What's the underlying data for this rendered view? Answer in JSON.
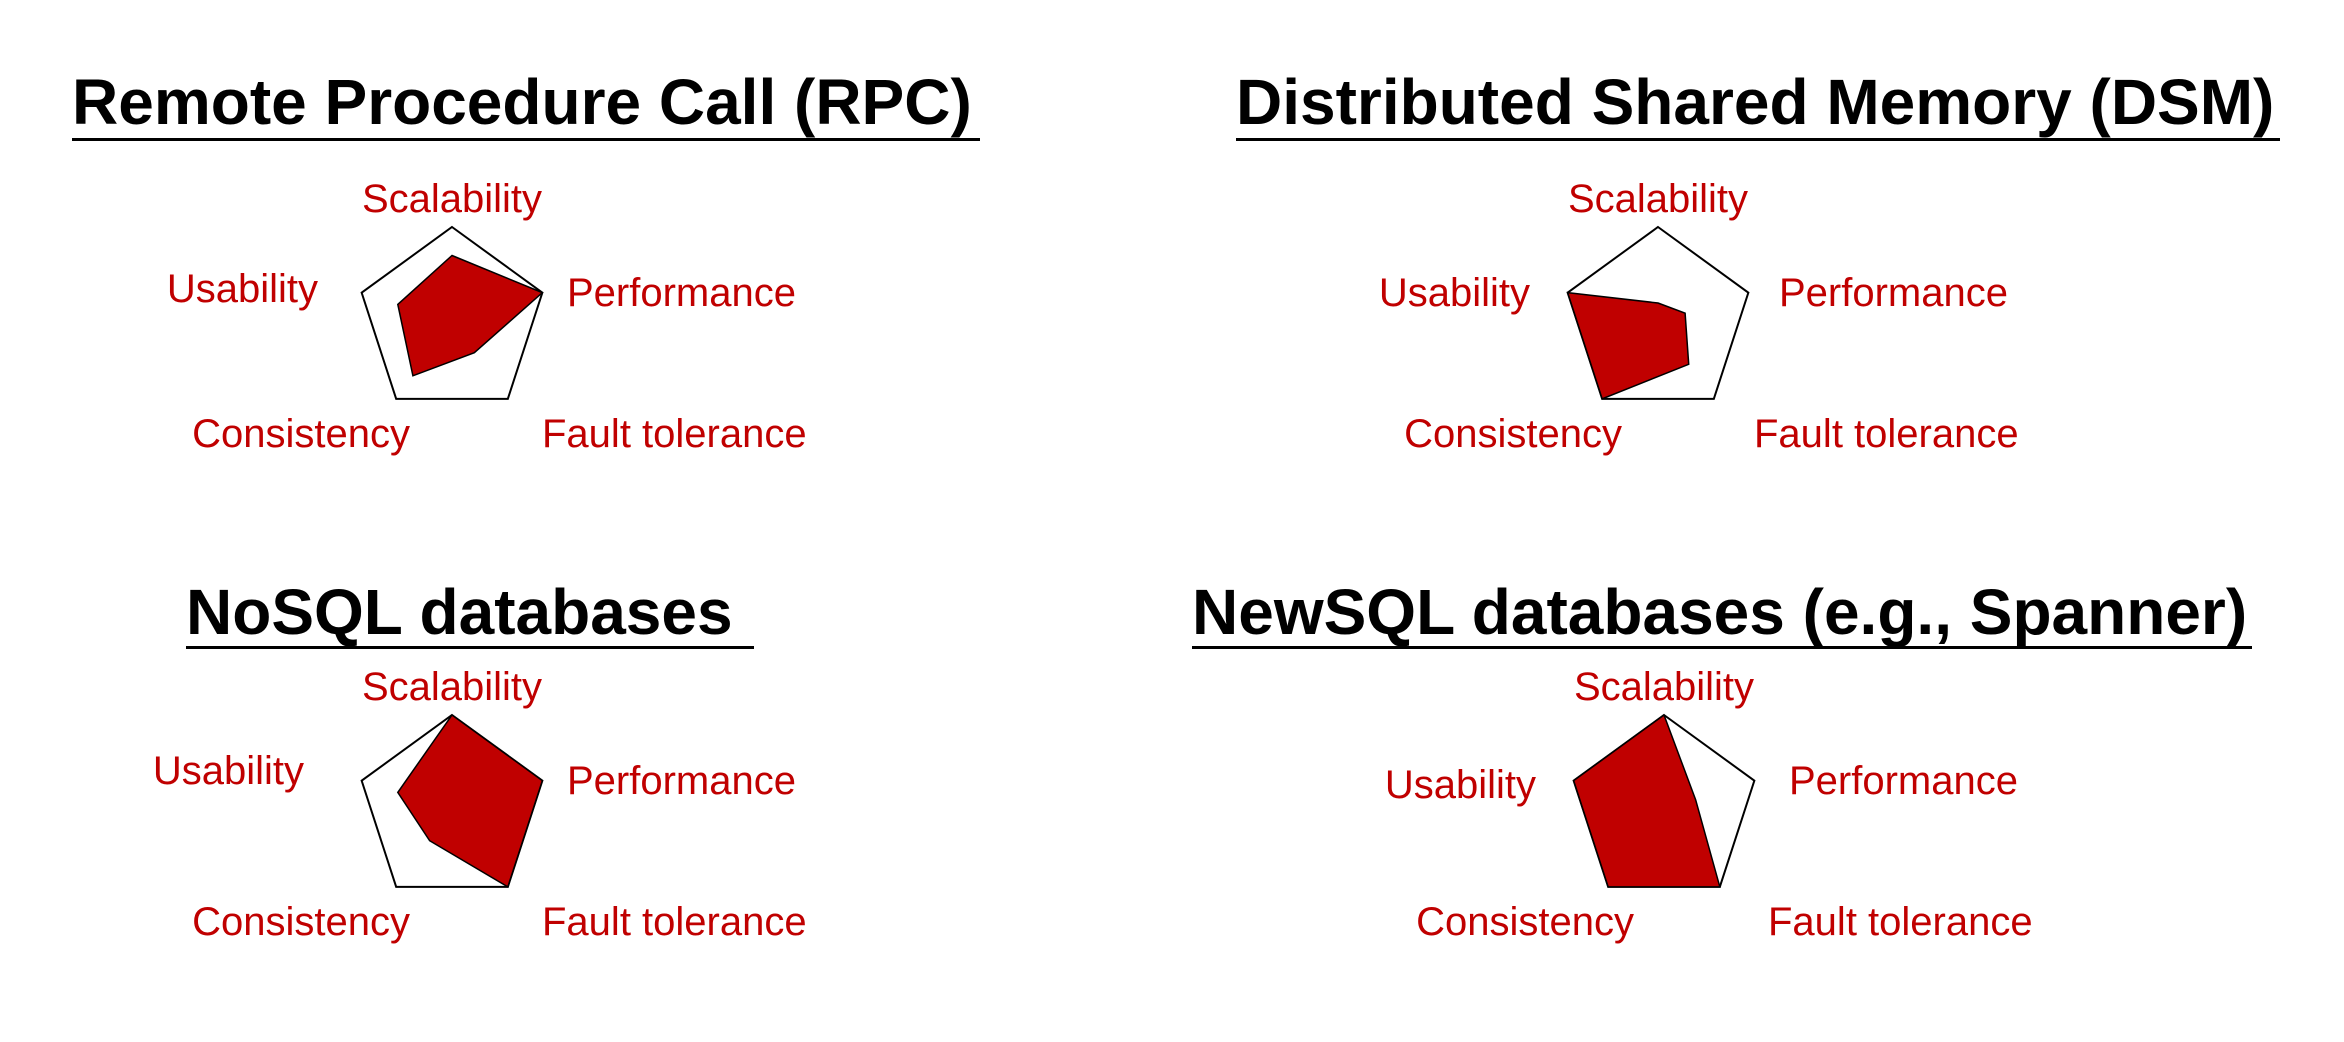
{
  "colors": {
    "fill": "#c00000",
    "label": "#c00000",
    "outline": "#000000",
    "title": "#000000"
  },
  "chart_data": [
    {
      "type": "radar",
      "title": "Remote Procedure Call (RPC)",
      "axes": [
        "Scalability",
        "Performance",
        "Fault tolerance",
        "Consistency",
        "Usability"
      ],
      "values": [
        0.7,
        1.0,
        0.4,
        0.7,
        0.6
      ],
      "range": [
        0,
        1
      ],
      "grid": false,
      "legend": "none"
    },
    {
      "type": "radar",
      "title": "Distributed Shared Memory (DSM)",
      "axes": [
        "Scalability",
        "Performance",
        "Fault tolerance",
        "Consistency",
        "Usability"
      ],
      "values": [
        0.2,
        0.3,
        0.55,
        1.0,
        1.0
      ],
      "range": [
        0,
        1
      ],
      "grid": false,
      "legend": "none"
    },
    {
      "type": "radar",
      "title": "NoSQL databases",
      "axes": [
        "Scalability",
        "Performance",
        "Fault tolerance",
        "Consistency",
        "Usability"
      ],
      "values": [
        1.0,
        1.0,
        1.0,
        0.4,
        0.6
      ],
      "range": [
        0,
        1
      ],
      "grid": false,
      "legend": "none"
    },
    {
      "type": "radar",
      "title": "NewSQL databases (e.g., Spanner)",
      "axes": [
        "Scalability",
        "Performance",
        "Fault tolerance",
        "Consistency",
        "Usability"
      ],
      "values": [
        1.0,
        0.35,
        1.0,
        1.0,
        1.0
      ],
      "range": [
        0,
        1
      ],
      "grid": false,
      "legend": "none"
    }
  ]
}
